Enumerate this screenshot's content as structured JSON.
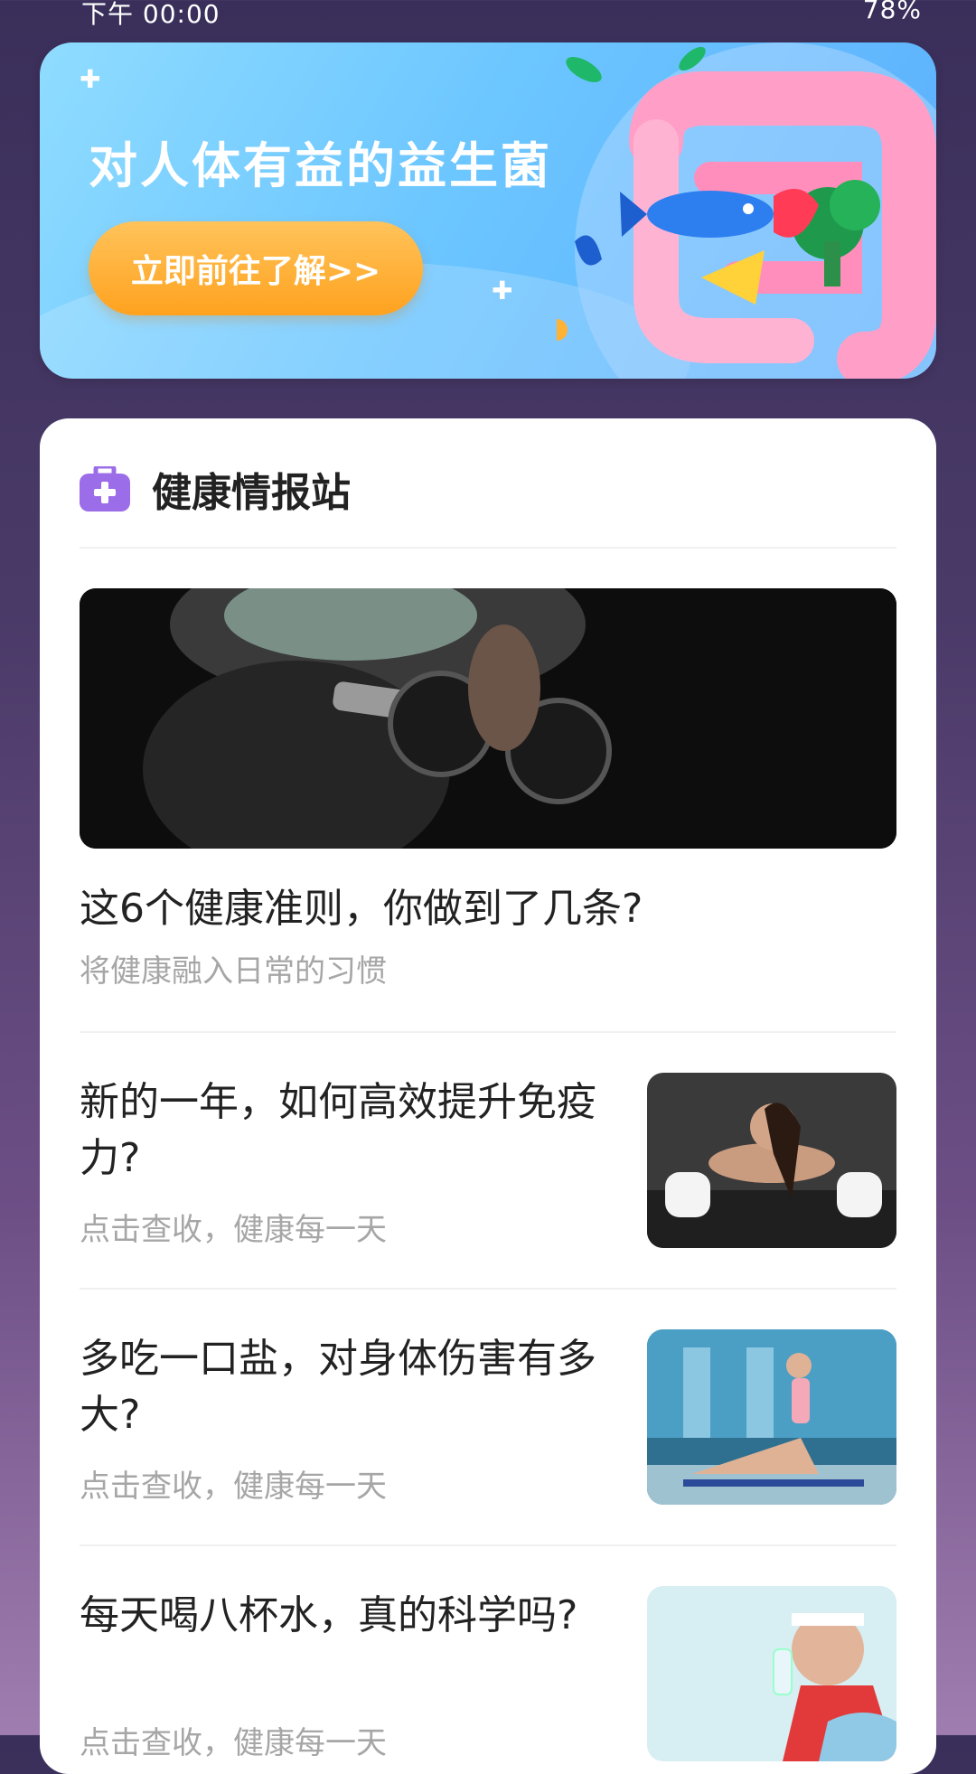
{
  "status_bar": {
    "time": "下午 00:00",
    "battery": "78%"
  },
  "banner": {
    "title": "对人体有益的益生菌",
    "button_label": "立即前往了解>>"
  },
  "health_station": {
    "title": "健康情报站",
    "featured": {
      "title": "这6个健康准则，你做到了几条?",
      "subtitle": "将健康融入日常的习惯"
    },
    "articles": [
      {
        "title": "新的一年，如何高效提升免疫力?",
        "subtitle": "点击查收，健康每一天"
      },
      {
        "title": "多吃一口盐，对身体伤害有多大?",
        "subtitle": "点击查收，健康每一天"
      },
      {
        "title": "每天喝八杯水，真的科学吗?",
        "subtitle": "点击查收，健康每一天"
      }
    ]
  },
  "icons": {
    "header": "medical-kit-icon"
  }
}
